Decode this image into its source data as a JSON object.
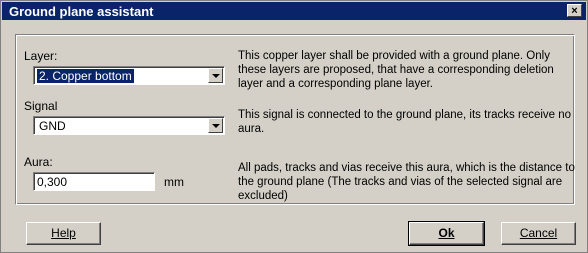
{
  "window": {
    "title": "Ground plane assistant",
    "close_label": "×"
  },
  "layer": {
    "label": "Layer:",
    "value": "2. Copper bottom",
    "description": "This copper layer shall be provided with a ground plane. Only these layers are proposed, that have a corresponding deletion layer and a corresponding plane layer."
  },
  "signal": {
    "label": "Signal",
    "value": "GND",
    "description": "This signal is connected to the ground plane, its tracks receive no aura."
  },
  "aura": {
    "label": "Aura:",
    "value": "0,300",
    "unit": "mm",
    "description": "All pads, tracks and vias receive this aura, which is the distance to the ground plane (The tracks and vias of the selected signal are excluded)"
  },
  "buttons": {
    "help": "Help",
    "ok": "Ok",
    "cancel": "Cancel"
  }
}
